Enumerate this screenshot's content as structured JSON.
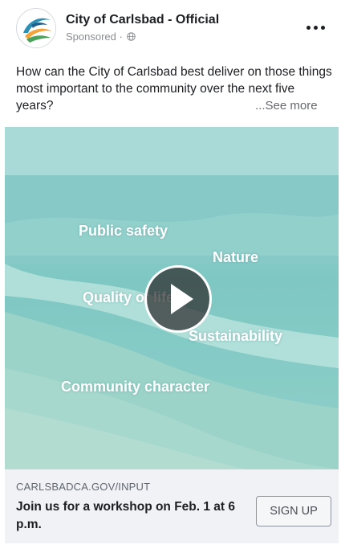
{
  "post": {
    "page_name": "City of Carlsbad - Official",
    "sponsored_label": "Sponsored",
    "privacy_icon": "globe-icon",
    "menu_icon": "more-options-icon",
    "body": "How can the City of Carlsbad best deliver on those things most important to the community over the next five years?",
    "see_more": "...See more"
  },
  "video": {
    "words": [
      "Public safety",
      "Nature",
      "Quality of life",
      "Sustainability",
      "Community character"
    ],
    "play_icon": "play-icon"
  },
  "cta": {
    "url": "CARLSBADCA.GOV/INPUT",
    "title": "Join us for a workshop on Feb. 1 at 6 p.m.",
    "button_label": "SIGN UP"
  },
  "colors": {
    "text": "#1c1e21",
    "muted": "#65676b",
    "cta_background": "#f0f2f5",
    "video_teal": "#8fcfcd"
  }
}
